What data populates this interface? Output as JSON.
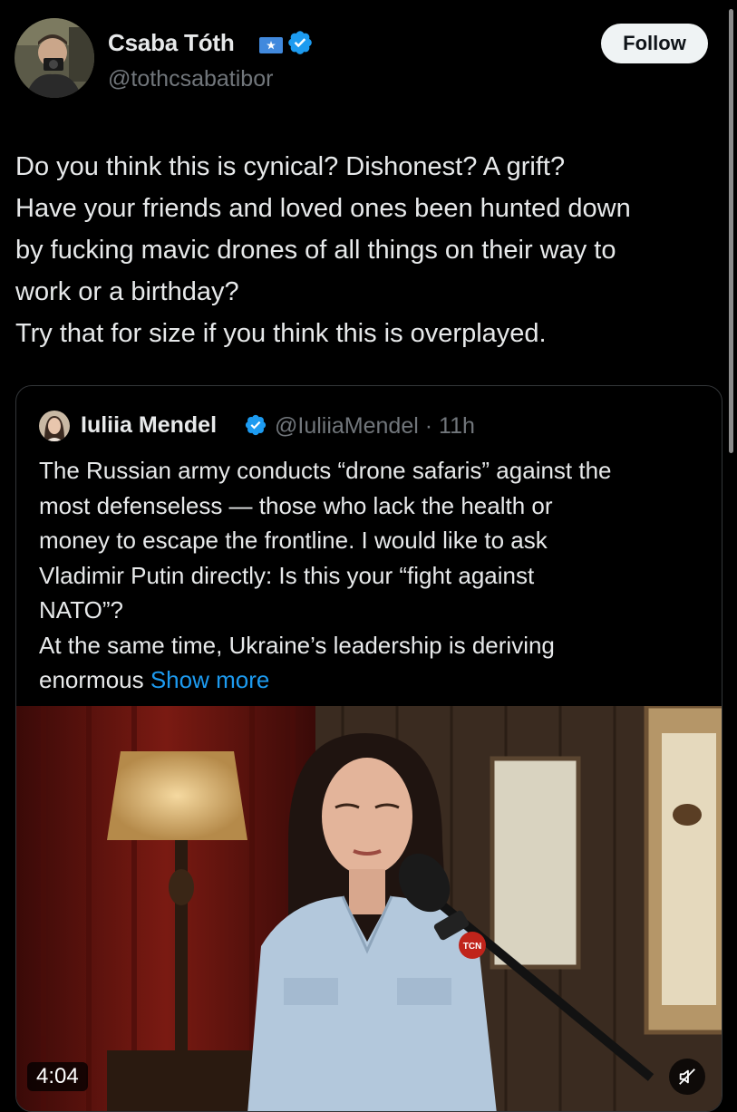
{
  "author": {
    "name": "Csaba Tóth",
    "handle": "@tothcsabatibor",
    "follow_label": "Follow"
  },
  "tweet": {
    "lines": [
      "Do you think this is cynical? Dishonest? A grift?",
      "Have your friends and loved ones been hunted down",
      "by fucking mavic drones of all things on their way to",
      "work or a birthday?",
      "Try that for size if you think this is overplayed."
    ]
  },
  "quote": {
    "name": "Iuliia Mendel",
    "handle": "@IuliiaMendel",
    "time": "· 11h",
    "lines": [
      "The Russian army conducts “drone safaris” against the",
      "most defenseless — those who lack the health or",
      "money to escape the frontline. I would like to ask",
      "Vladimir Putin directly: Is this your “fight against",
      "NATO”?",
      "At the same time, Ukraine’s leadership is deriving"
    ],
    "last_line_prefix": "enormous ",
    "show_more": "Show more"
  },
  "video": {
    "duration": "4:04",
    "logo_text": "TCN"
  },
  "colors": {
    "background": "#000000",
    "text": "#e7e9ea",
    "muted": "#71767b",
    "link": "#1d9bf0",
    "verified": "#1d9bf0"
  }
}
